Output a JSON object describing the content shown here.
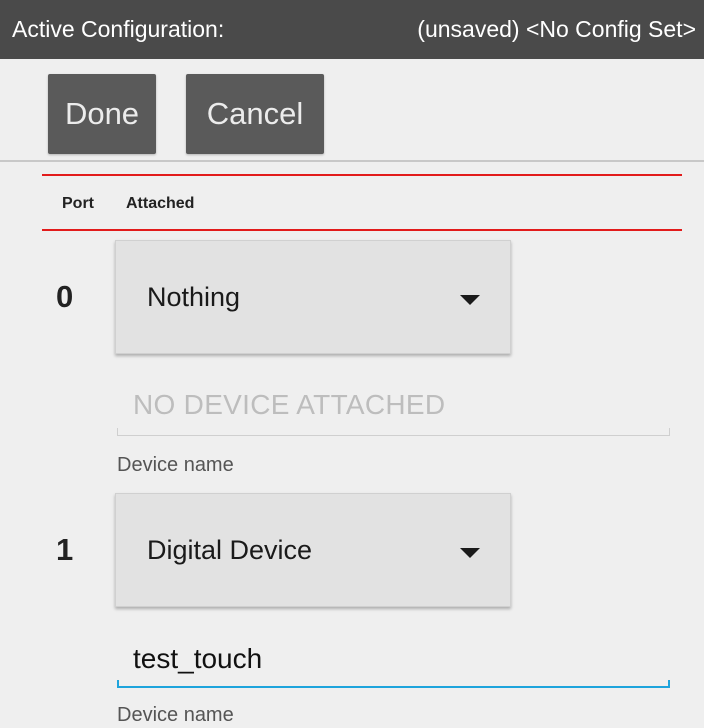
{
  "status_bar": {
    "title": "Active Configuration:",
    "config": "(unsaved) <No Config Set>"
  },
  "toolbar": {
    "done_label": "Done",
    "cancel_label": "Cancel"
  },
  "table_header": {
    "port": "Port",
    "attached": "Attached"
  },
  "ports": [
    {
      "number": "0",
      "device_type": "Nothing",
      "name_placeholder": "NO DEVICE ATTACHED",
      "name_value": "",
      "helper": "Device name"
    },
    {
      "number": "1",
      "device_type": "Digital Device",
      "name_placeholder": "",
      "name_value": "test_touch",
      "helper": "Device name"
    }
  ],
  "colors": {
    "status_bar": "#4a4a4a",
    "button": "#5a5a5a",
    "header_rule": "#e21b1b",
    "focus_underline": "#1ea4dc"
  }
}
